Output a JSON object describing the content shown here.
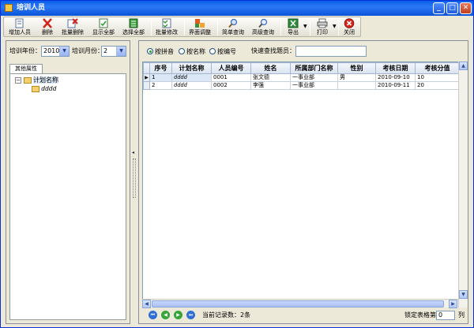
{
  "window": {
    "title": "培训人员"
  },
  "toolbar": {
    "items": [
      {
        "label": "增加人员",
        "icon": "add-document-icon"
      },
      {
        "label": "删除",
        "icon": "delete-x-icon"
      },
      {
        "label": "批量删除",
        "icon": "batch-delete-icon"
      },
      {
        "label": "显示全部",
        "icon": "show-all-icon"
      },
      {
        "label": "选择全部",
        "icon": "select-all-icon"
      },
      {
        "label": "批量修改",
        "icon": "batch-edit-icon"
      },
      {
        "label": "界面调整",
        "icon": "layout-adjust-icon"
      },
      {
        "label": "简单查询",
        "icon": "simple-search-icon"
      },
      {
        "label": "高级查询",
        "icon": "advanced-search-icon"
      },
      {
        "label": "导出",
        "icon": "excel-export-icon"
      },
      {
        "label": "打印",
        "icon": "printer-icon"
      },
      {
        "label": "关闭",
        "icon": "close-circle-icon"
      }
    ]
  },
  "left": {
    "year_label": "培训年份：",
    "year_value": "2010",
    "month_label": "培训月份：",
    "month_value": "2",
    "tab_label": "其他属性",
    "tree": {
      "root_label": "计划名称",
      "child_label": "dddd"
    }
  },
  "right": {
    "radios": [
      {
        "label": "按拼音",
        "checked": true
      },
      {
        "label": "按名称",
        "checked": false
      },
      {
        "label": "按编号",
        "checked": false
      }
    ],
    "quick_search_label": "快速查找题员：",
    "quick_search_value": "",
    "grid": {
      "columns": [
        "序号",
        "计划名称",
        "人员编号",
        "姓名",
        "所属部门名称",
        "性别",
        "考核日期",
        "考核分值"
      ],
      "rows": [
        {
          "indicator": "▶",
          "cells": [
            "1",
            "dddd",
            "0001",
            "张文德",
            "一事业部",
            "男",
            "2010-09-10",
            "10"
          ]
        },
        {
          "indicator": "",
          "cells": [
            "2",
            "dddd",
            "0002",
            "李强",
            "一事业部",
            "",
            "2010-09-11",
            "20"
          ]
        }
      ]
    },
    "status": {
      "record_count_text": "当前记录数：2条",
      "lock_columns_label": "锁定表格第",
      "lock_columns_value": "0",
      "lock_columns_unit": "列"
    }
  },
  "colors": {
    "titlebar": "#0a5ee8",
    "selected_row": "#dbe7f7",
    "header": "#d9e3f0"
  }
}
